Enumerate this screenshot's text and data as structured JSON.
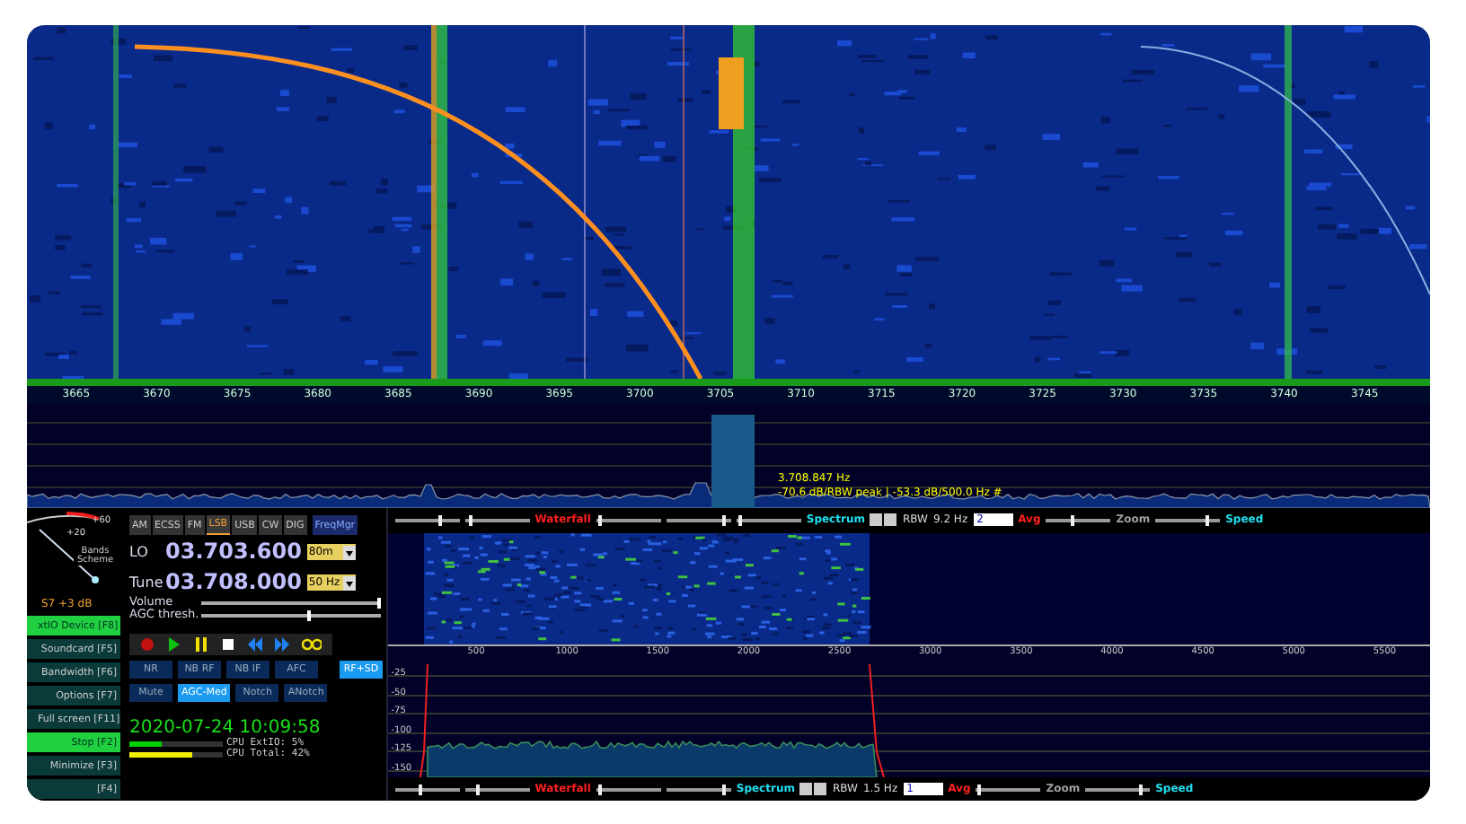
{
  "main_display": {
    "axis_labels": [
      "3665",
      "3670",
      "3675",
      "3680",
      "3685",
      "3690",
      "3695",
      "3700",
      "3705",
      "3710",
      "3715",
      "3720",
      "3725",
      "3730",
      "3735",
      "3740",
      "3745"
    ],
    "marker": {
      "frequency": "3.708.847 Hz",
      "reading": "-70.6 dB/RBW peak | -53.3 dB/500.0 Hz #"
    }
  },
  "s_meter": {
    "scale": [
      "+60",
      "+20"
    ],
    "button": "Bands Scheme",
    "reading": "S7 +3 dB"
  },
  "function_buttons": [
    {
      "label": "xtIO Device [F8]",
      "on": true
    },
    {
      "label": "Soundcard [F5]",
      "on": false
    },
    {
      "label": "Bandwidth [F6]",
      "on": false
    },
    {
      "label": "Options [F7]",
      "on": false
    },
    {
      "label": "Full screen [F11]",
      "on": false
    },
    {
      "label": "Stop [F2]",
      "on": true
    },
    {
      "label": "Minimize [F3]",
      "on": false
    },
    {
      "label": "[F4]",
      "on": false
    }
  ],
  "modes": [
    {
      "label": "AM",
      "selected": false
    },
    {
      "label": "ECSS",
      "selected": false
    },
    {
      "label": "FM",
      "selected": false
    },
    {
      "label": "LSB",
      "selected": true
    },
    {
      "label": "USB",
      "selected": false
    },
    {
      "label": "CW",
      "selected": false
    },
    {
      "label": "DIG",
      "selected": false
    }
  ],
  "freq_manager": "FreqMgr",
  "lo": {
    "label": "LO",
    "value": "03.703.600",
    "dropdown": "80m"
  },
  "tune": {
    "label": "Tune",
    "value": "03.708.000",
    "dropdown": "50 Hz"
  },
  "volume": {
    "label": "Volume",
    "level": 0.99
  },
  "agc_threshold": {
    "label": "AGC thresh.",
    "level": 0.6
  },
  "dsp_rows": [
    [
      {
        "label": "NR",
        "on": false
      },
      {
        "label": "NB RF",
        "on": false
      },
      {
        "label": "NB IF",
        "on": false
      },
      {
        "label": "AFC",
        "on": false
      },
      {
        "label": "RF+SD",
        "on": true
      }
    ],
    [
      {
        "label": "Mute",
        "on": false
      },
      {
        "label": "AGC-Med",
        "on": true
      },
      {
        "label": "Notch",
        "on": false
      },
      {
        "label": "ANotch",
        "on": false
      }
    ]
  ],
  "datetime": "2020-07-24 10:09:58",
  "cpu": [
    {
      "label": "CPU ExtIO: 5%",
      "level": 0.35,
      "color": "#00d000"
    },
    {
      "label": "CPU Total: 42%",
      "level": 0.68,
      "color": "#f0f000"
    }
  ],
  "audio": {
    "top_toolbar": [
      {
        "kind": "slider",
        "level": 0.7
      },
      {
        "kind": "slider",
        "level": 0.1
      },
      {
        "kind": "label",
        "text": "Waterfall",
        "color": "#ff2020"
      },
      {
        "kind": "slider",
        "level": 0.05
      },
      {
        "kind": "slider",
        "level": 0.9
      },
      {
        "kind": "slider",
        "level": 0.05
      },
      {
        "kind": "label",
        "text": "Spectrum",
        "color": "#20e0f0"
      },
      {
        "kind": "stepper"
      },
      {
        "kind": "text",
        "text": "RBW"
      },
      {
        "kind": "text",
        "text": "9.2 Hz"
      },
      {
        "kind": "dropdown",
        "text": "2"
      },
      {
        "kind": "label",
        "text": "Avg",
        "color": "#ff2020"
      },
      {
        "kind": "slider",
        "level": 0.4
      },
      {
        "kind": "label",
        "text": "Zoom",
        "color": "#a0a0a0"
      },
      {
        "kind": "slider",
        "level": 0.8
      },
      {
        "kind": "label",
        "text": "Speed",
        "color": "#20e0f0"
      }
    ],
    "axis_labels": [
      "500",
      "1000",
      "1500",
      "2000",
      "2500",
      "3000",
      "3500",
      "4000",
      "4500",
      "5000",
      "5500"
    ],
    "db_labels": [
      "-25",
      "-50",
      "-75",
      "-100",
      "-125",
      "-150"
    ],
    "bottom_toolbar": [
      {
        "kind": "slider",
        "level": 0.4
      },
      {
        "kind": "slider",
        "level": 0.2
      },
      {
        "kind": "label",
        "text": "Waterfall",
        "color": "#ff2020"
      },
      {
        "kind": "slider",
        "level": 0.05
      },
      {
        "kind": "slider",
        "level": 0.9
      },
      {
        "kind": "label",
        "text": "Spectrum",
        "color": "#20e0f0"
      },
      {
        "kind": "stepper"
      },
      {
        "kind": "text",
        "text": "RBW"
      },
      {
        "kind": "text",
        "text": "1.5 Hz"
      },
      {
        "kind": "dropdown",
        "text": "1"
      },
      {
        "kind": "label",
        "text": "Avg",
        "color": "#ff2020"
      },
      {
        "kind": "slider",
        "level": 0.05
      },
      {
        "kind": "label",
        "text": "Zoom",
        "color": "#a0a0a0"
      },
      {
        "kind": "slider",
        "level": 0.85
      },
      {
        "kind": "label",
        "text": "Speed",
        "color": "#20e0f0"
      }
    ]
  }
}
